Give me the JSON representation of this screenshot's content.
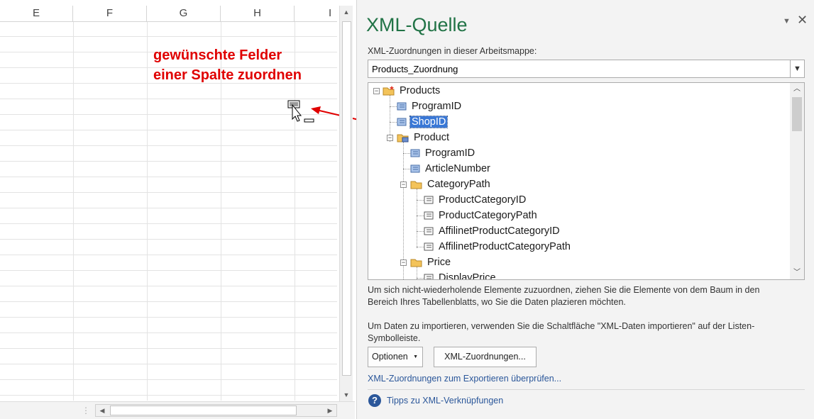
{
  "sheet": {
    "columns": [
      "E",
      "F",
      "G",
      "H",
      "I"
    ],
    "annotation": {
      "line1": "gewünschte Felder",
      "line2": "einer Spalte zuordnen",
      "color": "#e00000"
    }
  },
  "pane": {
    "title": "XML-Quelle",
    "title_color": "#217346",
    "menu_icon": "chevron-down-icon",
    "close_icon": "close-icon",
    "maps_label": "XML-Zuordnungen in dieser Arbeitsmappe:",
    "maps_selected": "Products_Zuordnung",
    "tree": {
      "nodes": [
        {
          "label": "Products",
          "kind": "root-folder",
          "level": 0,
          "expanded": true
        },
        {
          "label": "ProgramID",
          "kind": "element",
          "level": 1
        },
        {
          "label": "ShopID",
          "kind": "element",
          "level": 1,
          "selected": true
        },
        {
          "label": "Product",
          "kind": "repeating-folder",
          "level": 1,
          "expanded": true
        },
        {
          "label": "ProgramID",
          "kind": "element",
          "level": 2
        },
        {
          "label": "ArticleNumber",
          "kind": "element",
          "level": 2
        },
        {
          "label": "CategoryPath",
          "kind": "folder",
          "level": 2,
          "expanded": true
        },
        {
          "label": "ProductCategoryID",
          "kind": "element",
          "level": 3
        },
        {
          "label": "ProductCategoryPath",
          "kind": "element",
          "level": 3
        },
        {
          "label": "AffilinetProductCategoryID",
          "kind": "element",
          "level": 3
        },
        {
          "label": "AffilinetProductCategoryPath",
          "kind": "element",
          "level": 3
        },
        {
          "label": "Price",
          "kind": "folder",
          "level": 2,
          "expanded": true
        },
        {
          "label": "DisplayPrice",
          "kind": "element",
          "level": 3
        }
      ]
    },
    "help1": "Um sich nicht-wiederholende Elemente zuzuordnen, ziehen Sie die Elemente von dem Baum in den Bereich Ihres Tabellenblatts, wo Sie die Daten plazieren möchten.",
    "help2": "Um Daten zu importieren, verwenden Sie die Schaltfläche \"XML-Daten importieren\" auf der Listen-Symbolleiste.",
    "options_label": "Optionen",
    "maps_button": "XML-Zuordnungen...",
    "verify_link": "XML-Zuordnungen zum Exportieren überprüfen...",
    "help_icon": "question-icon",
    "tips_link": "Tipps zu XML-Verknüpfungen",
    "link_color": "#2b579a",
    "selection_color": "#3a78d6"
  }
}
